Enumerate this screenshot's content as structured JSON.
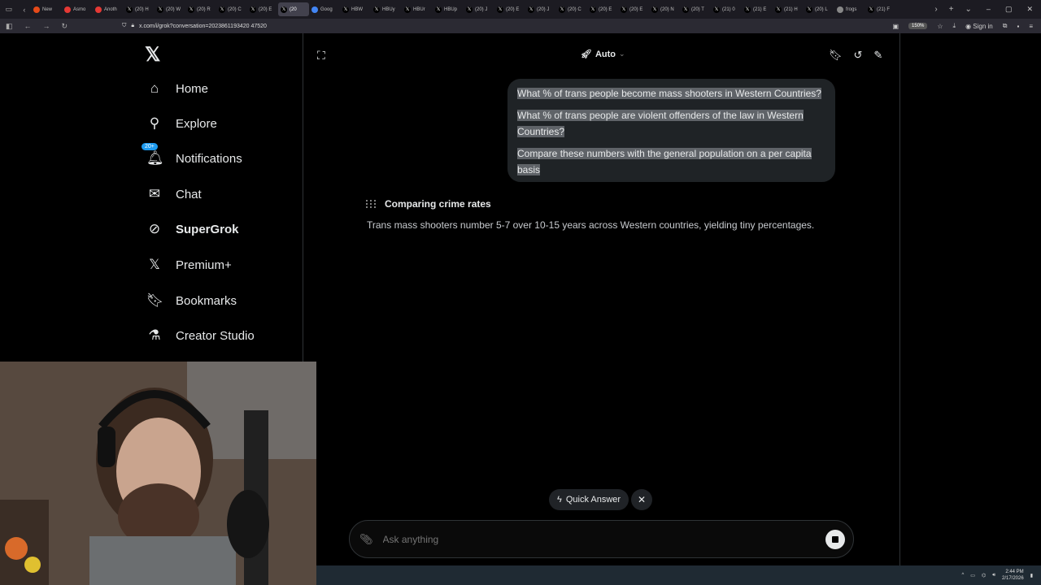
{
  "browser": {
    "tabs": [
      {
        "label": "New",
        "color": "#e64a19",
        "icon": "reddit-icon"
      },
      {
        "label": "Asmo",
        "color": "#e53935",
        "icon": "reddit-icon"
      },
      {
        "label": "Anoth",
        "color": "#e53935",
        "icon": "reddit-icon"
      },
      {
        "label": "(20) H",
        "color": "#000000",
        "icon": "x-icon"
      },
      {
        "label": "(20) W",
        "color": "#000000",
        "icon": "x-icon"
      },
      {
        "label": "(20) R",
        "color": "#000000",
        "icon": "x-icon"
      },
      {
        "label": "(20) C",
        "color": "#000000",
        "icon": "x-icon"
      },
      {
        "label": "(20) E",
        "color": "#000000",
        "icon": "x-icon"
      },
      {
        "label": "(20",
        "color": "#000000",
        "icon": "x-icon",
        "active": true
      },
      {
        "label": "Goog",
        "color": "#4285f4",
        "icon": "google-icon"
      },
      {
        "label": "HBW",
        "color": "#000000",
        "icon": "x-icon"
      },
      {
        "label": "HBUy",
        "color": "#000000",
        "icon": "x-icon"
      },
      {
        "label": "HBUr",
        "color": "#000000",
        "icon": "x-icon"
      },
      {
        "label": "HBUp",
        "color": "#000000",
        "icon": "x-icon"
      },
      {
        "label": "(20) J",
        "color": "#000000",
        "icon": "x-icon"
      },
      {
        "label": "(20) E",
        "color": "#000000",
        "icon": "x-icon"
      },
      {
        "label": "(20) J",
        "color": "#000000",
        "icon": "x-icon"
      },
      {
        "label": "(20) C",
        "color": "#000000",
        "icon": "x-icon"
      },
      {
        "label": "(20) E",
        "color": "#000000",
        "icon": "x-icon"
      },
      {
        "label": "(20) E",
        "color": "#000000",
        "icon": "x-icon"
      },
      {
        "label": "(20) N",
        "color": "#000000",
        "icon": "x-icon"
      },
      {
        "label": "(20) T",
        "color": "#000000",
        "icon": "x-icon"
      },
      {
        "label": "(21) 0",
        "color": "#000000",
        "icon": "x-icon"
      },
      {
        "label": "(21) E",
        "color": "#000000",
        "icon": "x-icon"
      },
      {
        "label": "(21) H",
        "color": "#000000",
        "icon": "x-icon"
      },
      {
        "label": "(20) L",
        "color": "#000000",
        "icon": "x-icon"
      },
      {
        "label": "frogs",
        "color": "#888888",
        "icon": "globe-icon"
      },
      {
        "label": "(21) F",
        "color": "#000000",
        "icon": "x-icon"
      }
    ],
    "url": "x.com/i/grok?conversation=2023861193420 47520",
    "zoom": "150%",
    "sign_in": "Sign in"
  },
  "sidebar": {
    "items": [
      {
        "label": "Home",
        "icon": "home-icon",
        "glyph": "⌂"
      },
      {
        "label": "Explore",
        "icon": "search-icon",
        "glyph": "⚲"
      },
      {
        "label": "Notifications",
        "icon": "bell-icon",
        "glyph": "🔔︎",
        "badge": "20+"
      },
      {
        "label": "Chat",
        "icon": "mail-icon",
        "glyph": "✉"
      },
      {
        "label": "SuperGrok",
        "icon": "grok-icon",
        "glyph": "⊘"
      },
      {
        "label": "Premium+",
        "icon": "x-logo-icon",
        "glyph": "𝕏"
      },
      {
        "label": "Bookmarks",
        "icon": "bookmark-icon",
        "glyph": "🔖︎"
      },
      {
        "label": "Creator Studio",
        "icon": "flask-icon",
        "glyph": "⚗"
      }
    ]
  },
  "grok": {
    "model": "Auto",
    "user_message": [
      "What % of trans people become mass shooters in Western Countries?",
      "What % of trans people are violent offenders of the law in Western Countries?",
      "Compare these numbers with the general population on a per capita basis"
    ],
    "thinking_title": "Comparing crime rates",
    "answer": "Trans mass shooters number 5-7 over 10-15 years across Western countries, yielding tiny percentages.",
    "quick_answer": "Quick Answer",
    "input_placeholder": "Ask anything"
  },
  "taskbar": {
    "time": "2:44 PM",
    "date": "2/17/2026"
  }
}
